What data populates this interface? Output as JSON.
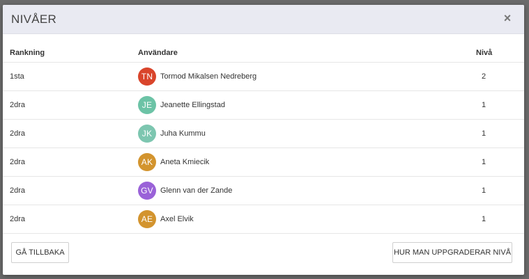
{
  "modal": {
    "title": "NIVÅER",
    "close_label": "×"
  },
  "table": {
    "headers": {
      "rank": "Rankning",
      "user": "Användare",
      "level": "Nivå"
    },
    "rows": [
      {
        "rank": "1sta",
        "initials": "TN",
        "name": "Tormod Mikalsen Nedreberg",
        "level": "2",
        "avatar_color": "#d9452b"
      },
      {
        "rank": "2dra",
        "initials": "JE",
        "name": "Jeanette Ellingstad",
        "level": "1",
        "avatar_color": "#6cc3a6"
      },
      {
        "rank": "2dra",
        "initials": "JK",
        "name": "Juha Kummu",
        "level": "1",
        "avatar_color": "#7dc6b0"
      },
      {
        "rank": "2dra",
        "initials": "AK",
        "name": "Aneta Kmiecik",
        "level": "1",
        "avatar_color": "#d3942e"
      },
      {
        "rank": "2dra",
        "initials": "GV",
        "name": "Glenn van der Zande",
        "level": "1",
        "avatar_color": "#9a62d8"
      },
      {
        "rank": "2dra",
        "initials": "AE",
        "name": "Axel Elvik",
        "level": "1",
        "avatar_color": "#d3942e"
      }
    ]
  },
  "buttons": {
    "back": "GÅ TILLBAKA",
    "upgrade": "HUR MAN UPPGRADERAR NIVÅ"
  }
}
